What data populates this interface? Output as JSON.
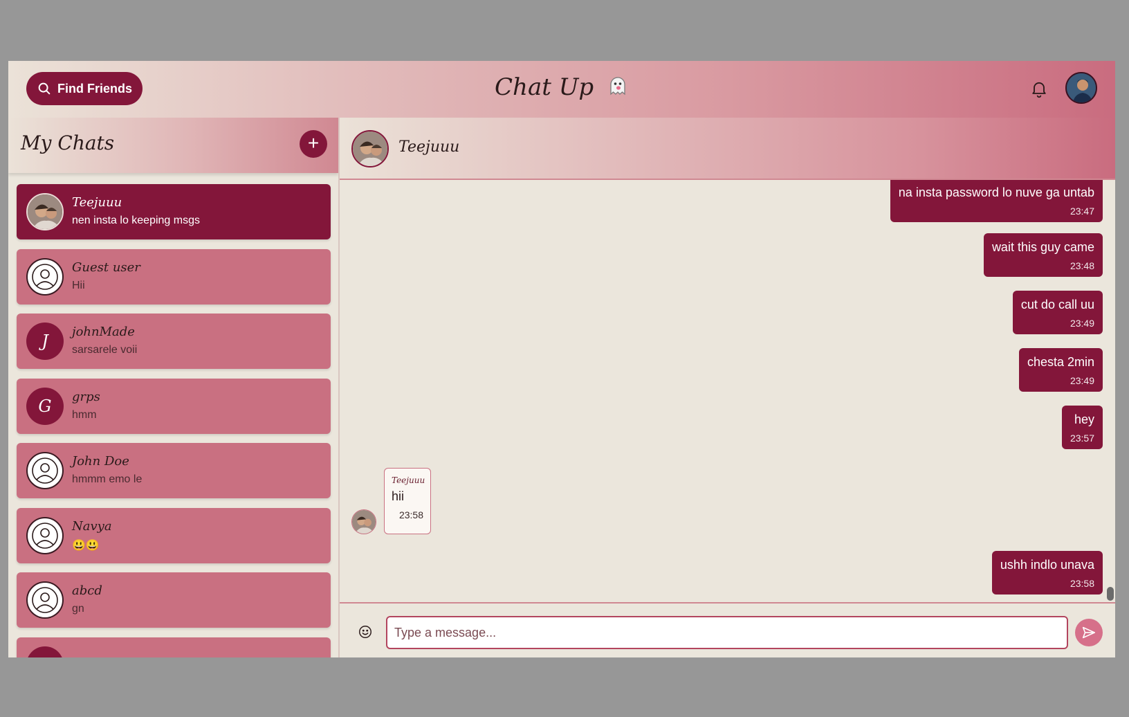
{
  "header": {
    "find_friends_label": "Find Friends",
    "app_title": "Chat Up",
    "ghost_icon": "ghost-icon",
    "bell_icon": "bell-icon"
  },
  "sidebar": {
    "title": "My Chats",
    "new_chat_label": "+",
    "chats": [
      {
        "name": "Teejuuu",
        "last": "nen insta lo keeping msgs",
        "avatar": "photo",
        "active": true
      },
      {
        "name": "Guest user",
        "last": "Hii",
        "avatar": "default"
      },
      {
        "name": "johnMade",
        "last": "sarsarele voii",
        "avatar": "letter",
        "letter": "J"
      },
      {
        "name": "grps",
        "last": "hmm",
        "avatar": "letter",
        "letter": "G"
      },
      {
        "name": "John Doe",
        "last": "hmmm emo le",
        "avatar": "default"
      },
      {
        "name": "Navya",
        "last": "😃😃",
        "avatar": "default"
      },
      {
        "name": "abcd",
        "last": "gn",
        "avatar": "default"
      },
      {
        "name": "",
        "last": "",
        "avatar": "letter",
        "letter": ""
      }
    ]
  },
  "chat": {
    "contact_name": "Teejuuu",
    "messages_sent": [
      {
        "text": "na insta password lo nuve ga untab",
        "time": "23:47"
      },
      {
        "text": "wait this guy came",
        "time": "23:48"
      },
      {
        "text": "cut do call uu",
        "time": "23:49"
      },
      {
        "text": "chesta 2min",
        "time": "23:49"
      },
      {
        "text": "hey",
        "time": "23:57"
      },
      {
        "text": "ushh indlo unava",
        "time": "23:58"
      }
    ],
    "message_received": {
      "sender": "Teejuuu",
      "text": "hii",
      "time": "23:58"
    }
  },
  "composer": {
    "placeholder": "Type a message...",
    "emoji_icon": "smiley-icon",
    "send_icon": "send-icon"
  },
  "colors": {
    "brand": "#83163a",
    "chat_item": "#c97081",
    "background": "#ebe6dc"
  }
}
